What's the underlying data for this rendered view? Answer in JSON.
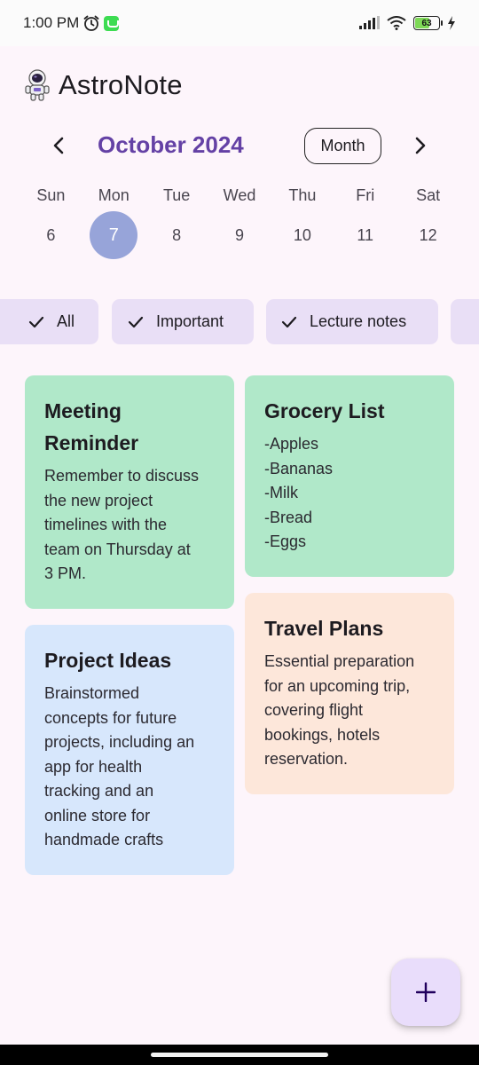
{
  "status_bar": {
    "time": "1:00 PM",
    "battery": "63"
  },
  "header": {
    "title": "AstroNote",
    "logo_icon": "astronaut-icon"
  },
  "calendar": {
    "month_label": "October 2024",
    "view_mode": "Month",
    "days": [
      {
        "name": "Sun",
        "number": "6"
      },
      {
        "name": "Mon",
        "number": "7",
        "selected": true
      },
      {
        "name": "Tue",
        "number": "8"
      },
      {
        "name": "Wed",
        "number": "9"
      },
      {
        "name": "Thu",
        "number": "10"
      },
      {
        "name": "Fri",
        "number": "11"
      },
      {
        "name": "Sat",
        "number": "12"
      }
    ]
  },
  "filters": [
    {
      "label": "All",
      "selected": true
    },
    {
      "label": "Important",
      "selected": true
    },
    {
      "label": "Lecture notes",
      "selected": true
    }
  ],
  "notes": [
    {
      "title": "Meeting\nReminder",
      "body": "Remember to discuss\nthe new project\ntimelines with the\nteam on Thursday at\n3 PM.",
      "color": "#b0e8c9"
    },
    {
      "title": "Grocery List",
      "body": "-Apples\n-Bananas\n-Milk\n-Bread\n-Eggs",
      "color": "#b0e8c9"
    },
    {
      "title": "Project Ideas",
      "body": "Brainstormed\nconcepts for future\nprojects, including an\napp for health\ntracking and an\nonline store for\nhandmade crafts",
      "color": "#d7e7fc"
    },
    {
      "title": "Travel Plans",
      "body": "Essential preparation\nfor an upcoming trip,\ncovering flight\nbookings, hotels\nreservation.",
      "color": "#fde7da"
    }
  ],
  "fab": {
    "icon": "plus-icon"
  },
  "colors": {
    "accent": "#6441a5",
    "selected_day": "#97a4d9",
    "chip": "#e9dff6",
    "background": "#fdf5fb"
  }
}
